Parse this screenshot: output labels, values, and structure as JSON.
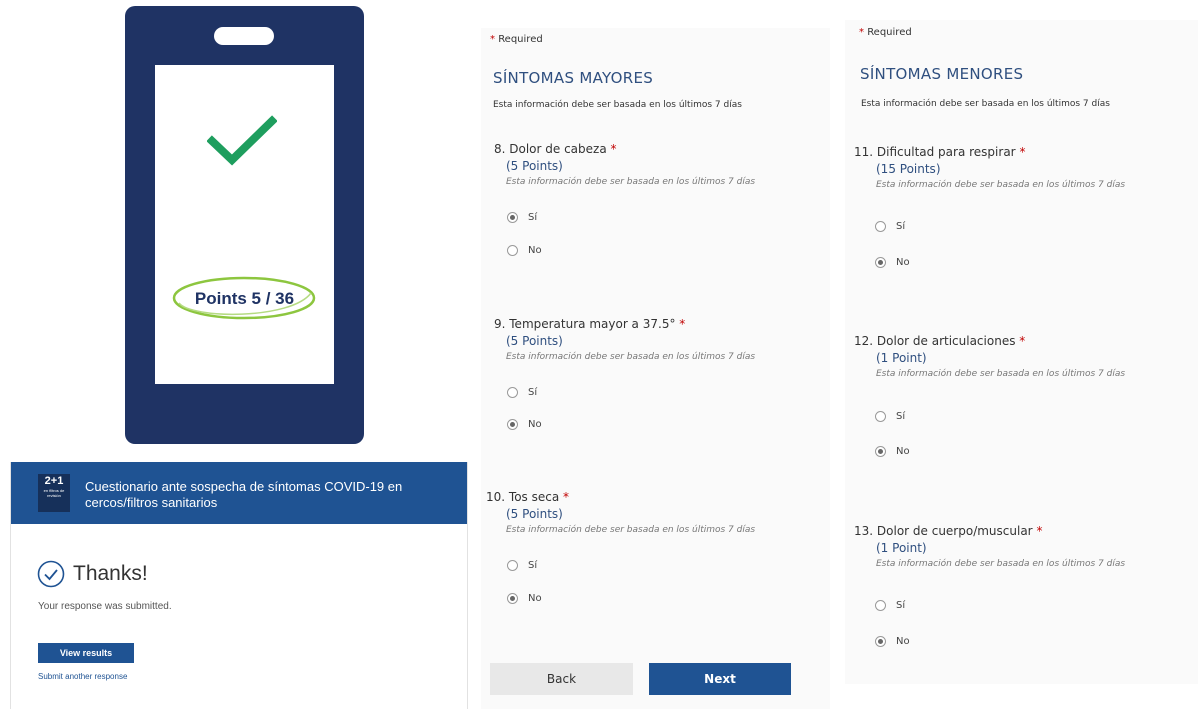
{
  "phone": {
    "score_text": "Points 5 / 36",
    "colors": {
      "frame": "#1f3364",
      "check": "#1e9e5e",
      "ellipse": "#8dc63f"
    }
  },
  "thanks_card": {
    "logo_text": "2+1",
    "logo_subtext": "en filtros de revisión",
    "header_title": "Cuestionario ante sospecha de síntomas COVID-19 en cercos/filtros sanitarios",
    "thanks_title": "Thanks!",
    "submitted_text": "Your response was submitted.",
    "view_results_label": "View results",
    "submit_another_label": "Submit another response",
    "colors": {
      "header": "#1f5393"
    }
  },
  "form_mayores": {
    "required_label": "Required",
    "section_title": "SÍNTOMAS MAYORES",
    "section_desc": "Esta información debe ser basada en los últimos 7 días",
    "questions": [
      {
        "label": "8. Dolor de cabeza",
        "points": "(5 Points)",
        "desc": "Esta información debe ser basada en los últimos 7 días",
        "options": [
          {
            "label": "Sí",
            "checked": true
          },
          {
            "label": "No",
            "checked": false
          }
        ]
      },
      {
        "label": "9. Temperatura mayor a 37.5°",
        "points": "(5 Points)",
        "desc": "Esta información debe ser basada en los últimos 7 días",
        "options": [
          {
            "label": "Sí",
            "checked": false
          },
          {
            "label": "No",
            "checked": true
          }
        ]
      },
      {
        "label": "10. Tos seca",
        "points": "(5 Points)",
        "desc": "Esta información debe ser basada en los últimos 7 días",
        "options": [
          {
            "label": "Sí",
            "checked": false
          },
          {
            "label": "No",
            "checked": true
          }
        ]
      }
    ],
    "back_label": "Back",
    "next_label": "Next"
  },
  "form_menores": {
    "required_label": "Required",
    "section_title": "SÍNTOMAS MENORES",
    "section_desc": "Esta información debe ser basada en los últimos 7 días",
    "questions": [
      {
        "label": "11. Dificultad para respirar",
        "points": "(15 Points)",
        "desc": "Esta información debe ser basada en los últimos 7 días",
        "options": [
          {
            "label": "Sí",
            "checked": false
          },
          {
            "label": "No",
            "checked": true
          }
        ]
      },
      {
        "label": "12. Dolor de articulaciones",
        "points": "(1 Point)",
        "desc": "Esta información debe ser basada en los últimos 7 días",
        "options": [
          {
            "label": "Sí",
            "checked": false
          },
          {
            "label": "No",
            "checked": true
          }
        ]
      },
      {
        "label": "13. Dolor de cuerpo/muscular",
        "points": "(1 Point)",
        "desc": "Esta información debe ser basada en los últimos 7 días",
        "options": [
          {
            "label": "Sí",
            "checked": false
          },
          {
            "label": "No",
            "checked": true
          }
        ]
      }
    ]
  }
}
